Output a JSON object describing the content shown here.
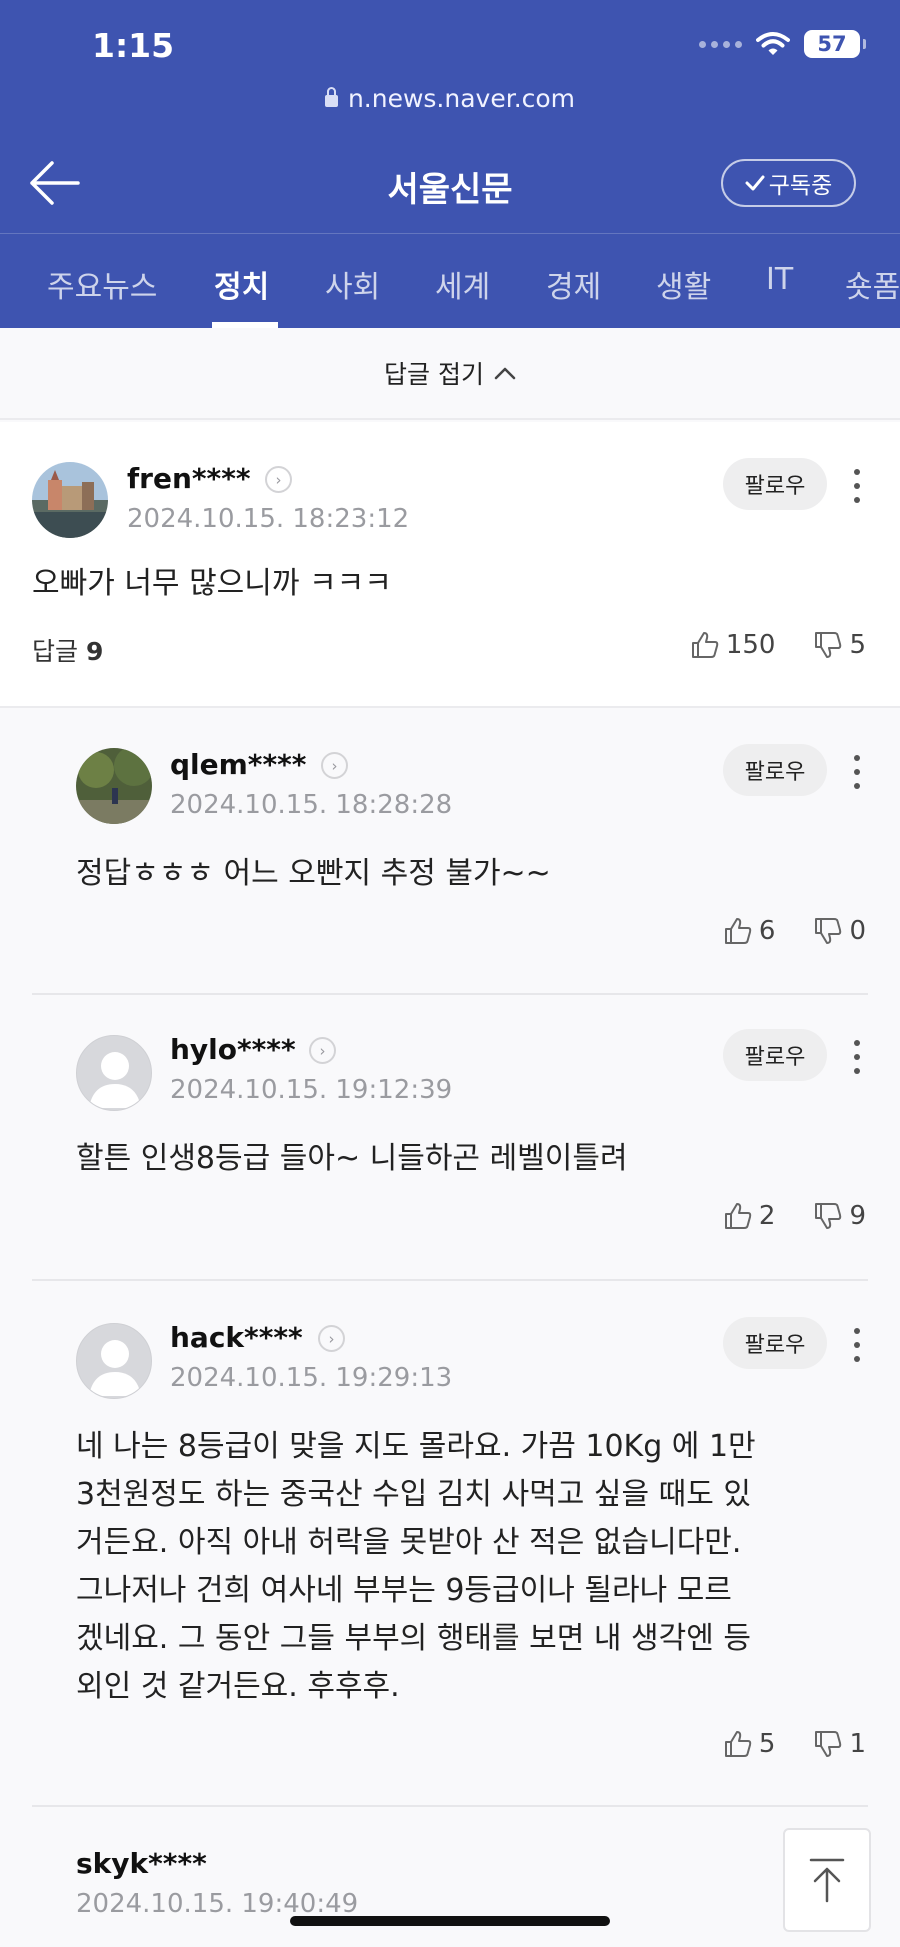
{
  "status_bar": {
    "time": "1:15",
    "battery": "57"
  },
  "browser": {
    "url": "n.news.naver.com"
  },
  "header": {
    "title": "서울신문",
    "subscribe_label": "구독중"
  },
  "tabs": [
    {
      "label": "주요뉴스",
      "active": false
    },
    {
      "label": "정치",
      "active": true
    },
    {
      "label": "사회",
      "active": false
    },
    {
      "label": "세계",
      "active": false
    },
    {
      "label": "경제",
      "active": false
    },
    {
      "label": "생활",
      "active": false
    },
    {
      "label": "IT",
      "active": false
    },
    {
      "label": "숏폼",
      "active": false
    }
  ],
  "collapse": {
    "label": "답글 접기"
  },
  "follow_label": "팔로우",
  "comments": [
    {
      "username": "fren****",
      "timestamp": "2024.10.15. 18:23:12",
      "text": "오빠가 너무 많으니까 ㅋㅋㅋ",
      "replies_label": "답글",
      "replies_count": "9",
      "likes": "150",
      "dislikes": "5"
    },
    {
      "username": "qlem****",
      "timestamp": "2024.10.15. 18:28:28",
      "text": "정답ㅎㅎㅎ 어느 오빤지 추정 불가~~",
      "likes": "6",
      "dislikes": "0"
    },
    {
      "username": "hylo****",
      "timestamp": "2024.10.15. 19:12:39",
      "text": "할튼 인생8등급 들아~ 니들하곤 레벨이틀려",
      "likes": "2",
      "dislikes": "9"
    },
    {
      "username": "hack****",
      "timestamp": "2024.10.15. 19:29:13",
      "lines": [
        "네 나는 8등급이 맞을 지도 몰라요. 가끔 10Kg 에 1만",
        "3천원정도 하는 중국산 수입 김치 사먹고 싶을 때도 있",
        "거든요. 아직 아내 허락을 못받아 산 적은 없습니다만.",
        "그나저나 건희 여사네 부부는 9등급이나 될라나 모르",
        "겠네요. 그 동안 그들 부부의 행태를 보면 내 생각엔 등",
        "외인 것 같거든요. 후후후."
      ],
      "likes": "5",
      "dislikes": "1"
    },
    {
      "username": "skyk****",
      "timestamp": "2024.10.15. 19:40:49"
    }
  ]
}
